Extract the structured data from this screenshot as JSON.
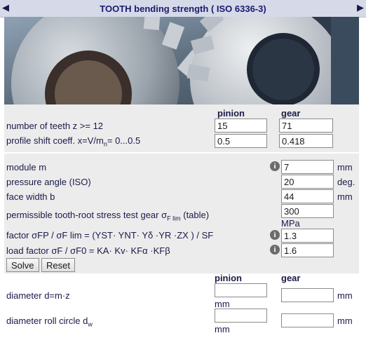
{
  "header": {
    "title": "TOOTH bending strength ( ISO 6336-3)",
    "left_arrow": "◀",
    "right_arrow": "▶"
  },
  "columns": {
    "pinion": "pinion",
    "gear": "gear"
  },
  "inputs": {
    "teeth": {
      "label": "number of teeth z >= 12",
      "pinion": "15",
      "gear": "71"
    },
    "shift": {
      "label_pre": "profile shift coeff.  x=V/m",
      "label_sub": "n",
      "label_post": "= 0...0.5",
      "pinion": "0.5",
      "gear": "0.418"
    },
    "module": {
      "label": "module m",
      "value": "7",
      "unit": "mm"
    },
    "pressure": {
      "label": "pressure angle (ISO)",
      "value": "20",
      "unit": "deg."
    },
    "face": {
      "label": "face width b",
      "value": "44",
      "unit": "mm"
    },
    "stress": {
      "label_pre": "permissible tooth-root stress test gear σ",
      "label_sub": "F lim",
      "label_post": " (table)",
      "value": "300",
      "unit": "MPa"
    },
    "factor": {
      "label": "factor σFP / σF lim = (YST· YNT· Yδ ·YR ·ZX ) / SF",
      "value": "1.3"
    },
    "load": {
      "label": "load factor σF / σF0 = KA· Kv· KFα ·KFβ",
      "value": "1.6"
    }
  },
  "buttons": {
    "solve": "Solve",
    "reset": "Reset"
  },
  "results": {
    "pinion": "pinion",
    "gear": "gear",
    "diameter": {
      "label": "diameter d=m·z",
      "pinion": "",
      "gear": "",
      "unit": "mm"
    },
    "roll": {
      "label_pre": "diameter roll circle d",
      "label_sub": "w",
      "pinion": "",
      "gear": "",
      "unit": "mm"
    }
  },
  "info_glyph": "i",
  "colors": {
    "panel": "#ececec",
    "titlebar": "#d6dae8",
    "text": "#1a1a4a"
  }
}
